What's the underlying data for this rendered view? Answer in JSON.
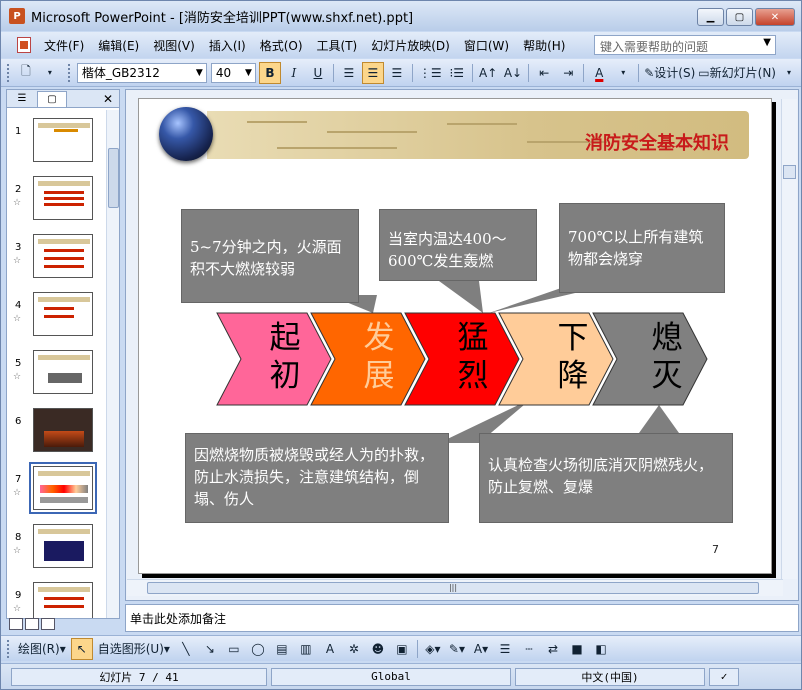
{
  "window": {
    "title": "Microsoft PowerPoint - [消防安全培训PPT(www.shxf.net).ppt]"
  },
  "menu": {
    "items": [
      "文件(F)",
      "编辑(E)",
      "视图(V)",
      "插入(I)",
      "格式(O)",
      "工具(T)",
      "幻灯片放映(D)",
      "窗口(W)",
      "帮助(H)"
    ],
    "help_placeholder": "键入需要帮助的问题"
  },
  "toolbar": {
    "font_name": "楷体_GB2312",
    "font_size": "40",
    "bold": "B",
    "italic": "I",
    "underline": "U",
    "design_label": "设计(S)",
    "new_slide_label": "新幻灯片(N)"
  },
  "thumbnails": {
    "numbers": [
      "1",
      "2",
      "3",
      "4",
      "5",
      "6",
      "7",
      "8",
      "9"
    ],
    "selected": "7"
  },
  "slide": {
    "title": "消防安全基本知识",
    "page_number": "7",
    "stages": [
      {
        "top": "起",
        "bottom": "初",
        "color": "#ff6699",
        "text_color": "#000000"
      },
      {
        "top": "发",
        "bottom": "展",
        "color": "#ff6600",
        "text_color": "#ffcc99"
      },
      {
        "top": "猛",
        "bottom": "烈",
        "color": "#ff0000",
        "text_color": "#000000"
      },
      {
        "top": "下",
        "bottom": "降",
        "color": "#ffcc99",
        "text_color": "#000000"
      },
      {
        "top": "熄",
        "bottom": "灭",
        "color": "#808080",
        "text_color": "#000000"
      }
    ],
    "callouts": {
      "c1": "5~7分钟之内，火源面积不大燃烧较弱",
      "c2": "当室内温达400～600℃发生轰燃",
      "c3": "700℃以上所有建筑物都会烧穿",
      "c4": "因燃烧物质被烧毁或经人为的扑救，防止水渍损失，注意建筑结构，倒塌、伤人",
      "c5": "认真检查火场彻底消灭阴燃残火，防止复燃、复爆"
    }
  },
  "notes": {
    "text": "单击此处添加备注"
  },
  "drawbar": {
    "draw_label": "绘图(R)",
    "autoshapes_label": "自选图形(U)"
  },
  "status": {
    "slide_info": "幻灯片 7 / 41",
    "template": "Global",
    "language": "中文(中国)"
  },
  "colors": {
    "title_red": "#c81b1b",
    "callout_gray": "#7f7f7f",
    "chrome_blue": "#c9daf2"
  }
}
